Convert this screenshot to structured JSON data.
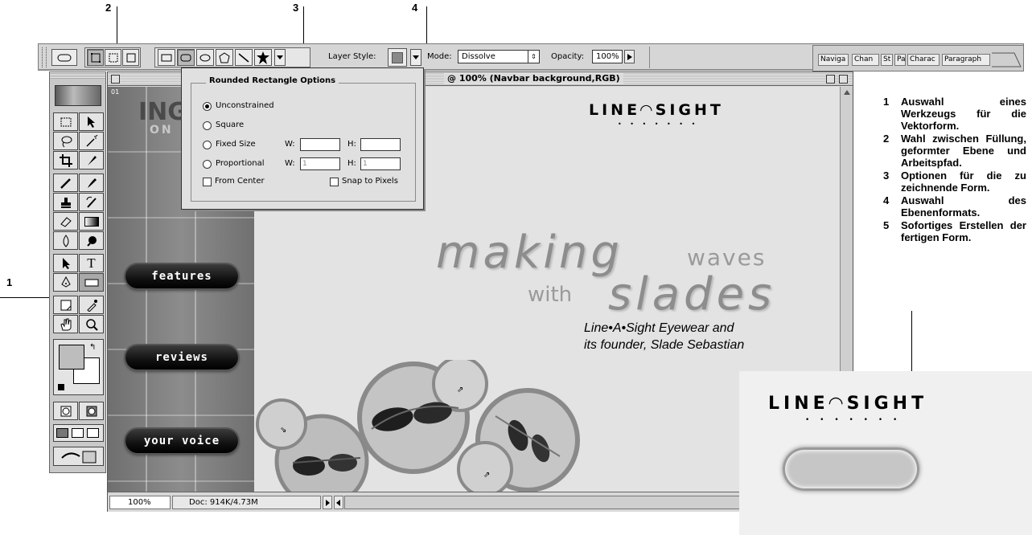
{
  "callouts": {
    "c1": "1",
    "c2": "2",
    "c3": "3",
    "c4": "4"
  },
  "options_bar": {
    "layer_style_label": "Layer Style:",
    "mode_label": "Mode:",
    "mode_value": "Dissolve",
    "opacity_label": "Opacity:",
    "opacity_value": "100%"
  },
  "palette_tabs": [
    "Naviga",
    "Chan",
    "St",
    "Pa",
    "Charac",
    "Paragraph"
  ],
  "popup": {
    "title": "Rounded Rectangle Options",
    "unconstrained": "Unconstrained",
    "square": "Square",
    "fixed_size": "Fixed Size",
    "proportional": "Proportional",
    "w_label": "W:",
    "h_label": "H:",
    "prop_w": "1",
    "prop_h": "1",
    "from_center": "From Center",
    "snap_to_pixels": "Snap to Pixels"
  },
  "document": {
    "title": "@ 100% (Navbar background,RGB)",
    "layer_badge": "01",
    "zoom": "100%",
    "doc_size": "Doc: 914K/4.73M"
  },
  "artwork": {
    "logo": "LINE◠SIGHT",
    "logo_dots": "• • • • • • •",
    "ing_text": "ING",
    "on_text": "ON",
    "making": "making",
    "waves": "waves",
    "with": "with",
    "slades": "slades",
    "tagline_1": "Line•A•Sight Eyewear and",
    "tagline_2": "its founder, Slade Sebastian",
    "nav_features": "features",
    "nav_reviews": "reviews",
    "nav_voice": "your voice"
  },
  "notes": [
    {
      "num": "1",
      "text": "Auswahl eines Werkzeugs für die Vektorform."
    },
    {
      "num": "2",
      "text": "Wahl zwischen Füllung, geformter Ebene und Arbeits­pfad."
    },
    {
      "num": "3",
      "text": "Optionen für die zu zeichnende Form."
    },
    {
      "num": "4",
      "text": "Auswahl des Ebenenformats."
    },
    {
      "num": "5",
      "text": "Sofortiges Erstellen der fertigen Form."
    }
  ],
  "inset": {
    "logo": "LINE◠SIGHT",
    "logo_dots": "• • • • • • •"
  },
  "colors": {
    "options_bar": "#d6d6d6",
    "canvas": "#e3e3e3",
    "nav_button": "#111111"
  }
}
